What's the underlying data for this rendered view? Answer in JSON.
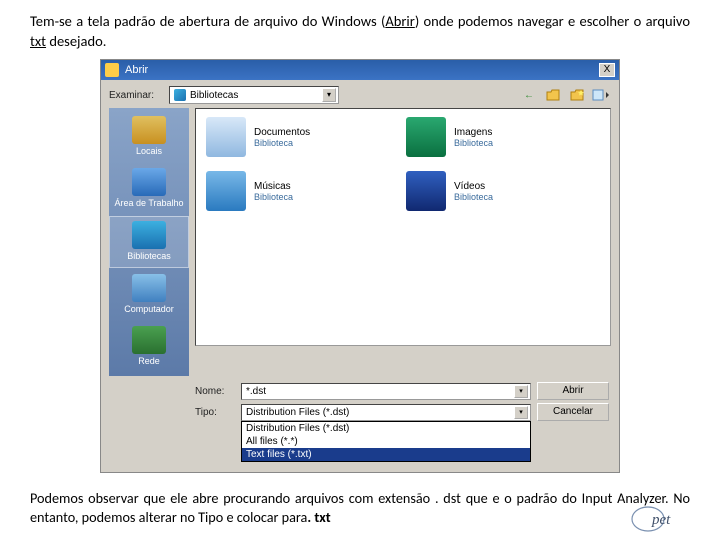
{
  "intro": {
    "pre": "Tem-se a tela padrão de abertura de arquivo do Windows (",
    "abrir": "Abrir",
    "post": ") onde podemos navegar e escolher o arquivo ",
    "txt": "txt",
    "tail": " desejado."
  },
  "dialog": {
    "title": "Abrir",
    "close": "X",
    "examinar_label": "Examinar:",
    "examinar_value": "Bibliotecas",
    "sidebar": [
      {
        "label": "Locais",
        "bg": "linear-gradient(#e0c060,#c89020)"
      },
      {
        "label": "Área de Trabalho",
        "bg": "linear-gradient(#6aa8e8,#286ab8)"
      },
      {
        "label": "Bibliotecas",
        "bg": "linear-gradient(#3cb0e0,#1a70b0)"
      },
      {
        "label": "Computador",
        "bg": "linear-gradient(#88c0e8,#4080c0)"
      },
      {
        "label": "Rede",
        "bg": "linear-gradient(#4aa050,#2a7030)"
      }
    ],
    "items": [
      {
        "title": "Documentos",
        "sub": "Biblioteca",
        "bg": "linear-gradient(#d8e8f8,#90b8e0)"
      },
      {
        "title": "Imagens",
        "sub": "Biblioteca",
        "bg": "linear-gradient(#2aa870,#0a7040)"
      },
      {
        "title": "Músicas",
        "sub": "Biblioteca",
        "bg": "linear-gradient(#78b8e8,#2a7ac0)"
      },
      {
        "title": "Vídeos",
        "sub": "Biblioteca",
        "bg": "linear-gradient(#3060c0,#102870)"
      }
    ],
    "nome_label": "Nome:",
    "nome_value": "*.dst",
    "tipo_label": "Tipo:",
    "tipo_value": "Distribution Files (*.dst)",
    "tipo_options": [
      "Distribution Files (*.dst)",
      "All files (*.*)",
      "Text files (*.txt)"
    ],
    "btn_open": "Abrir",
    "btn_cancel": "Cancelar",
    "arrow": "▾"
  },
  "outro": {
    "p1a": "Podemos observar que ele abre procurando arquivos com extensão ",
    "p1b": ". dst",
    "p1c": " que e o padrão do Input Analyzer. No entanto, podemos alterar no  Tipo e colocar para",
    "p1d": ". txt"
  }
}
